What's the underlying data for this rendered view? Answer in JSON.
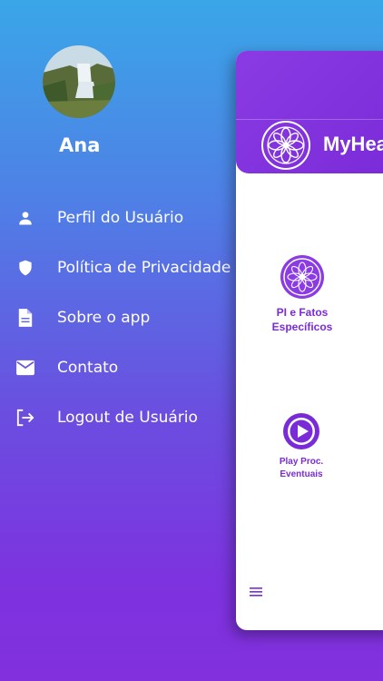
{
  "user": {
    "name": "Ana"
  },
  "menu": [
    {
      "label": "Perfil do Usuário",
      "icon": "person-icon"
    },
    {
      "label": "Política de Privacidade",
      "icon": "shield-icon"
    },
    {
      "label": "Sobre o app",
      "icon": "document-icon"
    },
    {
      "label": "Contato",
      "icon": "mail-icon"
    },
    {
      "label": "Logout de Usuário",
      "icon": "logout-icon"
    }
  ],
  "app": {
    "brand": "MyHeal",
    "tiles": [
      {
        "line1": "PI e Fatos",
        "line2": "Específicos",
        "icon": "mandala-logo-icon"
      },
      {
        "line1": "Play Proc.",
        "line2": "Eventuais",
        "icon": "play-icon"
      }
    ]
  },
  "colors": {
    "accent": "#7a2bd8",
    "gradient_top": "#3aa6e8",
    "gradient_bottom": "#8230de"
  }
}
